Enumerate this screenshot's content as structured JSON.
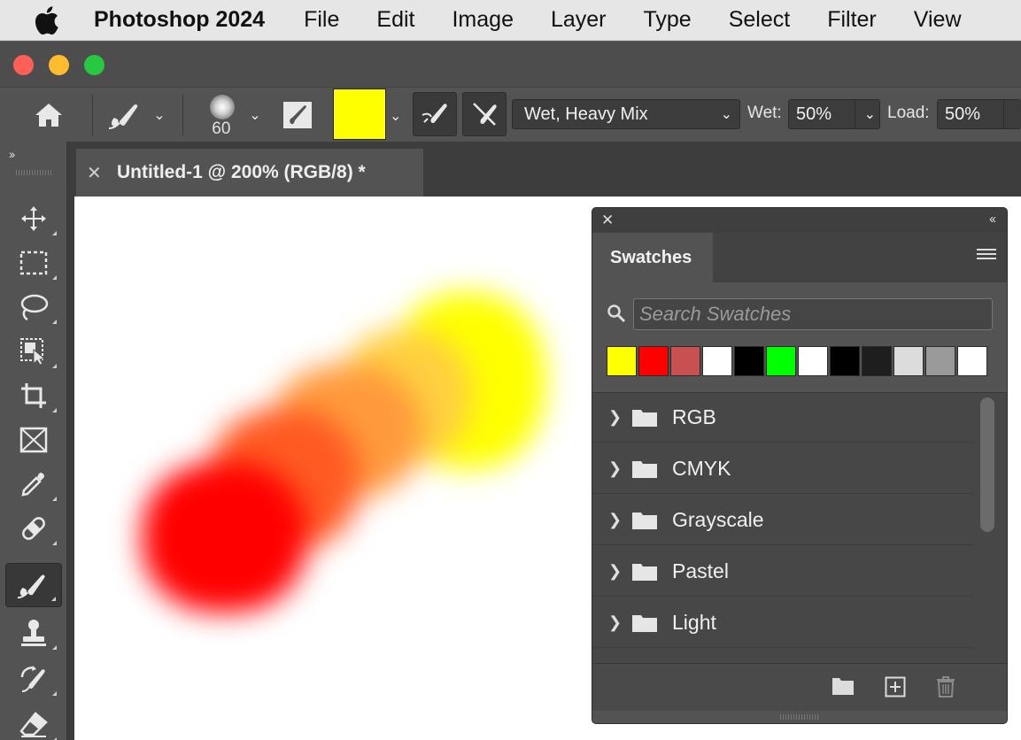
{
  "menubar": {
    "app_name": "Photoshop 2024",
    "items": [
      "File",
      "Edit",
      "Image",
      "Layer",
      "Type",
      "Select",
      "Filter",
      "View"
    ]
  },
  "options": {
    "brush_size": "60",
    "mode_value": "Wet, Heavy Mix",
    "wet_label": "Wet:",
    "wet_value": "50%",
    "load_label": "Load:",
    "load_value": "50%",
    "current_color": "#ffff00"
  },
  "document": {
    "tab_title": "Untitled-1 @ 200% (RGB/8) *"
  },
  "swatches_panel": {
    "tab_label": "Swatches",
    "search_placeholder": "Search Swatches",
    "recent_colors": [
      "#ffff00",
      "#ff0000",
      "#c85050",
      "#ffffff",
      "#000000",
      "#00ff00",
      "#ffffff",
      "#000000",
      "#1e1e1e",
      "#dcdcdc",
      "#9a9a9a",
      "#ffffff"
    ],
    "groups": [
      "RGB",
      "CMYK",
      "Grayscale",
      "Pastel",
      "Light"
    ]
  }
}
